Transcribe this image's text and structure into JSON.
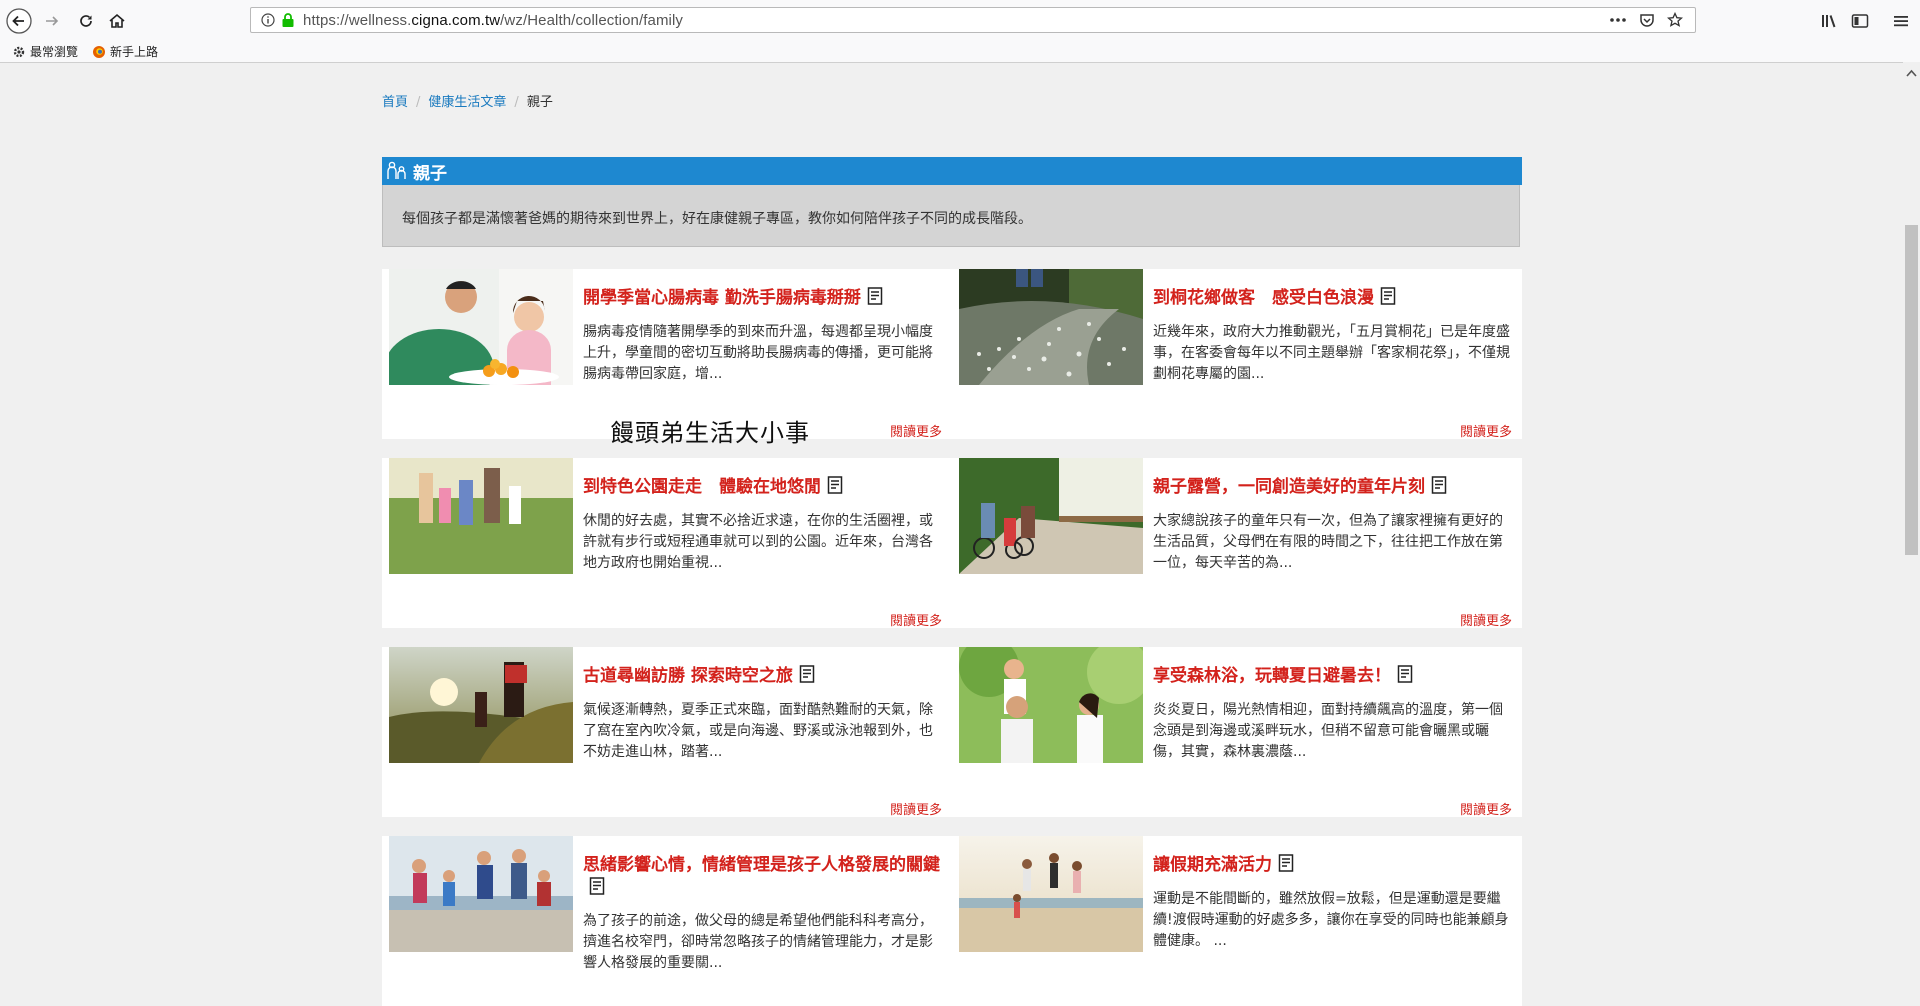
{
  "browser": {
    "url_prefix": "https://wellness.",
    "url_domain": "cigna.com.tw",
    "url_suffix": "/wz/Health/collection/family",
    "bookmarks": [
      "最常瀏覽",
      "新手上路"
    ]
  },
  "breadcrumb": {
    "home": "首頁",
    "section": "健康生活文章",
    "current": "親子"
  },
  "category": {
    "title": "親子",
    "description": "每個孩子都是滿懷著爸媽的期待來到世界上，好在康健親子專區，教你如何陪伴孩子不同的成長階段。"
  },
  "read_more": "閱讀更多",
  "watermark": "饅頭弟生活大小事",
  "articles": [
    {
      "title": "開學季當心腸病毒 勤洗手腸病毒掰掰",
      "excerpt": "腸病毒疫情隨著開學季的到來而升溫，每週都呈現小幅度上升，學童間的密切互動將助長腸病毒的傳播，更可能將腸病毒帶回家庭，增..."
    },
    {
      "title": "到桐花鄉做客　感受白色浪漫",
      "excerpt": "近幾年來，政府大力推動觀光，「五月賞桐花」已是年度盛事，在客委會每年以不同主題舉辦「客家桐花祭」，不僅規劃桐花專屬的園..."
    },
    {
      "title": "到特色公園走走　體驗在地悠閒",
      "excerpt": "休閒的好去處，其實不必捨近求遠，在你的生活圈裡，或許就有步行或短程通車就可以到的公園。近年來，台灣各地方政府也開始重視..."
    },
    {
      "title": "親子露營，一同創造美好的童年片刻",
      "excerpt": "大家總說孩子的童年只有一次，但為了讓家裡擁有更好的生活品質，父母們在有限的時間之下，往往把工作放在第一位，每天辛苦的為..."
    },
    {
      "title": "古道尋幽訪勝 探索時空之旅",
      "excerpt": "氣候逐漸轉熱，夏季正式來臨，面對酷熱難耐的天氣，除了窩在室內吹冷氣，或是向海邊、野溪或泳池報到外，也不妨走進山林，踏著..."
    },
    {
      "title": "享受森林浴，玩轉夏日避暑去！",
      "excerpt": "炎炎夏日，陽光熱情相迎，面對持續飆高的溫度，第一個念頭是到海邊或溪畔玩水，但稍不留意可能會曬黑或曬傷，其實，森林裏濃蔭..."
    },
    {
      "title": "思緒影響心情，情緒管理是孩子人格發展的關鍵",
      "excerpt": "為了孩子的前途，做父母的總是希望他們能科科考高分，擠進名校窄門，卻時常忽略孩子的情緒管理能力，才是影響人格發展的重要關..."
    },
    {
      "title": "讓假期充滿活力",
      "excerpt": "運動是不能間斷的，雖然放假=放鬆，但是運動還是要繼續!渡假時運動的好處多多，讓你在享受的同時也能兼顧身體健康。 ..."
    }
  ]
}
